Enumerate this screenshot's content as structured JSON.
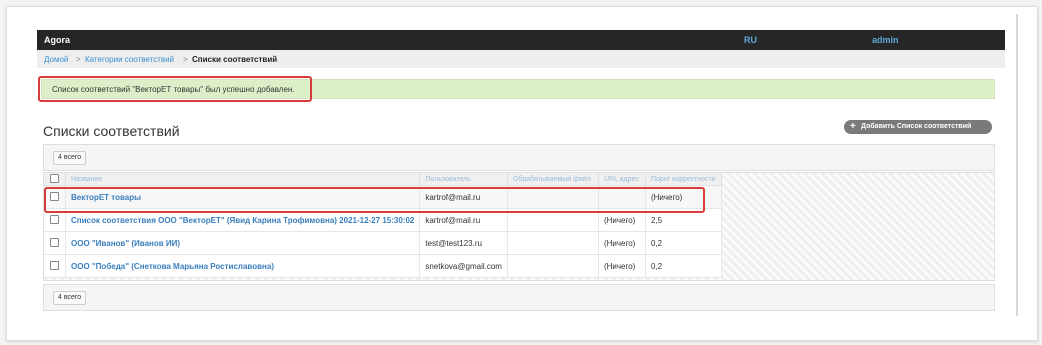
{
  "app": {
    "title": "Agora",
    "lang": "RU",
    "user": "admin"
  },
  "breadcrumb": {
    "home": "Домой",
    "sep": ">",
    "categories": "Категории соответствий",
    "current": "Списки соответствий"
  },
  "alert": {
    "message": "Список соответствий \"ВекторЕТ товары\" был успешно добавлен."
  },
  "page": {
    "heading": "Списки соответствий",
    "add_button": "Добавить Список соответствий",
    "add_icon": "plus-icon"
  },
  "pager": {
    "count_top": "4 всего",
    "count_bottom": "4 всего"
  },
  "table": {
    "columns": [
      "Название",
      "Пользователь",
      "Обрабатываемый файл",
      "URL адрес",
      "Порог корректности"
    ],
    "rows": [
      {
        "name": "ВекторЕТ товары",
        "user": "kartrof@mail.ru",
        "file": "",
        "url": "",
        "threshold": "(Ничего)"
      },
      {
        "name": "Список соответствия ООО \"ВекторЕТ\" (Явид Карина Трофимовна) 2021-12-27 15:30:02",
        "user": "kartrof@mail.ru",
        "file": "",
        "url": "(Ничего)",
        "threshold": "2,5"
      },
      {
        "name": "ООО \"Иванов\" (Иванов ИИ)",
        "user": "test@test123.ru",
        "file": "",
        "url": "(Ничего)",
        "threshold": "0,2"
      },
      {
        "name": "ООО \"Победа\" (Снеткова Марьяна Ростиславовна)",
        "user": "snetkova@gmail.com",
        "file": "",
        "url": "(Ничего)",
        "threshold": "0,2"
      }
    ]
  },
  "colors": {
    "highlight": "#d93a3a",
    "link": "#3a8fd1",
    "topbar": "#262626",
    "alert_bg": "#dcefc8"
  }
}
